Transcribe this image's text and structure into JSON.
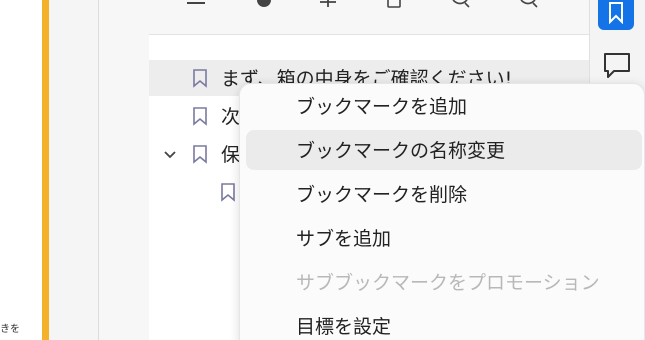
{
  "document": {
    "fragment_text": "きを"
  },
  "colors": {
    "accent": "#1473e6",
    "doc_margin": "#f4b22b",
    "selected_row": "#ededed",
    "menu_hover": "#ebebeb",
    "disabled_text": "#b8b8b8"
  },
  "toolbar": {
    "icons": [
      "menu-icon",
      "add-bookmark-icon",
      "promote-icon",
      "delete-icon",
      "search-icon",
      "search-icon"
    ]
  },
  "bookmarks": {
    "items": [
      {
        "label": "まず、箱の中身をご確認ください!",
        "icon": "bookmark-icon",
        "selected": true
      },
      {
        "label": "次",
        "icon": "bookmark-icon",
        "selected": false
      },
      {
        "label": "保",
        "icon": "bookmark-icon",
        "expanded": true
      },
      {
        "label": "",
        "icon": "bookmark-icon",
        "child": true
      }
    ]
  },
  "context_menu": {
    "items": [
      {
        "label": "ブックマークを追加",
        "enabled": true
      },
      {
        "label": "ブックマークの名称変更",
        "enabled": true,
        "hover": true
      },
      {
        "label": "ブックマークを削除",
        "enabled": true
      },
      {
        "label": "サブを追加",
        "enabled": true
      },
      {
        "label": "サブブックマークをプロモーション",
        "enabled": false
      },
      {
        "label": "目標を設定",
        "enabled": true
      }
    ]
  },
  "right_rail": {
    "items": [
      {
        "name": "bookmarks-icon",
        "active": true
      },
      {
        "name": "comment-icon",
        "active": false
      }
    ]
  }
}
